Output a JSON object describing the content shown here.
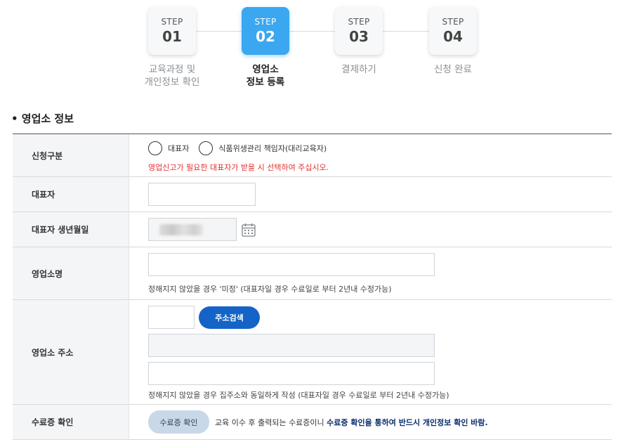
{
  "steps": [
    {
      "step_label": "STEP",
      "number": "01",
      "label": "교육과정 및\n개인정보 확인",
      "active": false
    },
    {
      "step_label": "STEP",
      "number": "02",
      "label": "영업소\n정보 등록",
      "active": true
    },
    {
      "step_label": "STEP",
      "number": "03",
      "label": "결제하기",
      "active": false
    },
    {
      "step_label": "STEP",
      "number": "04",
      "label": "신청 완료",
      "active": false
    }
  ],
  "section": {
    "title": "• 영업소 정보"
  },
  "form": {
    "apply_type": {
      "label": "신청구분",
      "options": [
        "대표자",
        "식품위생관리 책임자(대리교육자)"
      ],
      "warning": "영업신고가 필요한 대표자가 받을 시 선택하여 주십시오."
    },
    "representative": {
      "label": "대표자",
      "value": ""
    },
    "birthdate": {
      "label": "대표자 생년월일"
    },
    "business_name": {
      "label": "영업소명",
      "value": "",
      "note": "정해지지 않았을 경우 '미정' (대표자일 경우 수료일로 부터 2년내 수정가능)"
    },
    "address": {
      "label": "영업소 주소",
      "search_button": "주소검색",
      "note": "정해지지 않았을 경우 집주소와 동일하게 작성 (대표자일 경우 수료일로 부터 2년내 수정가능)"
    },
    "certificate": {
      "label": "수료증 확인",
      "button": "수료증 확인",
      "desc_prefix": "교육 이수 후 출력되는 수료증이니 ",
      "desc_bold": "수료증 확인을 통하여 반드시 개인정보 확인 바람."
    }
  },
  "colors": {
    "active_step": "#3aa7f0",
    "search_button": "#1464c8",
    "warning": "#e0322f"
  }
}
